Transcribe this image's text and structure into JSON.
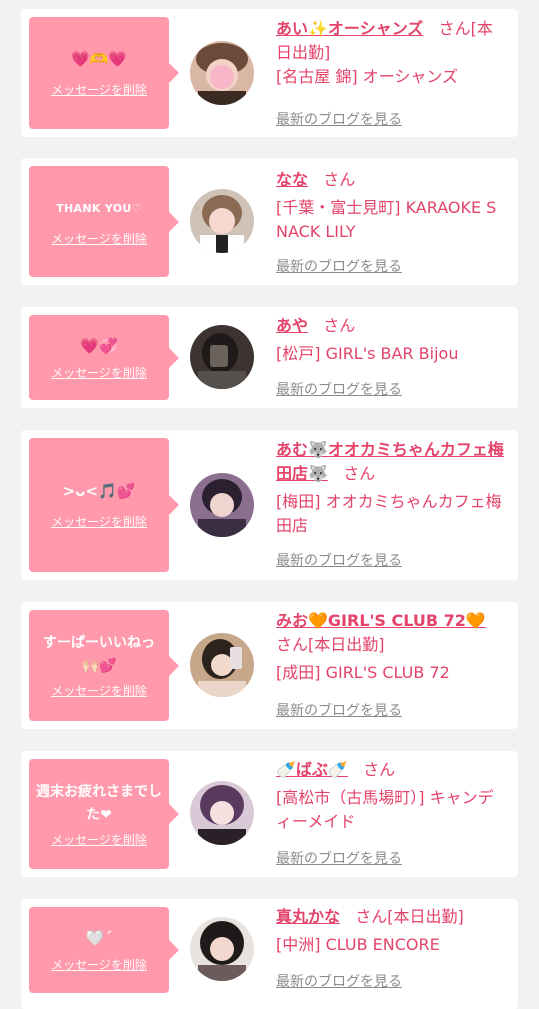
{
  "delete_label": "メッセージを削除",
  "blog_label": "最新のブログを見る",
  "san": "さん",
  "colors": {
    "bubble": "#ff99ab",
    "accent": "#e4436a",
    "muted": "#8c8c8c",
    "background": "#f2f2f2"
  },
  "cards": [
    {
      "message": "💗🫶💗",
      "name": "あい✨オーシャンズ",
      "status": "[本日出勤]",
      "shop": "[名古屋 錦] オーシャンズ"
    },
    {
      "message": "THANK YOU♡",
      "name": "なな",
      "status": "",
      "shop": "[千葉・富士見町] KARAOKE SNACK LILY"
    },
    {
      "message": "💗💞",
      "name": "あや",
      "status": "",
      "shop": "[松戸] GIRL's BAR Bijou"
    },
    {
      "message": ">ᴗ<🎵💕",
      "name": "あむ🐺オオカミちゃんカフェ梅田店🐺",
      "status": "",
      "shop": "[梅田] オオカミちゃんカフェ梅田店"
    },
    {
      "message": "すーぱーいいねっ🙌🏻💕",
      "name": "みお🧡GIRL'S CLUB 72🧡",
      "status": "[本日出勤]",
      "shop": "[成田] GIRL'S CLUB 72"
    },
    {
      "message": "週末お疲れさまでした❤",
      "name": "🍼ばぶ🍼",
      "status": "",
      "shop": "[高松市（古馬場町）] キャンディーメイド"
    },
    {
      "message": "🤍ˊ",
      "name": "真丸かな",
      "status": "[本日出勤]",
      "shop": "[中洲] CLUB ENCORE"
    }
  ]
}
